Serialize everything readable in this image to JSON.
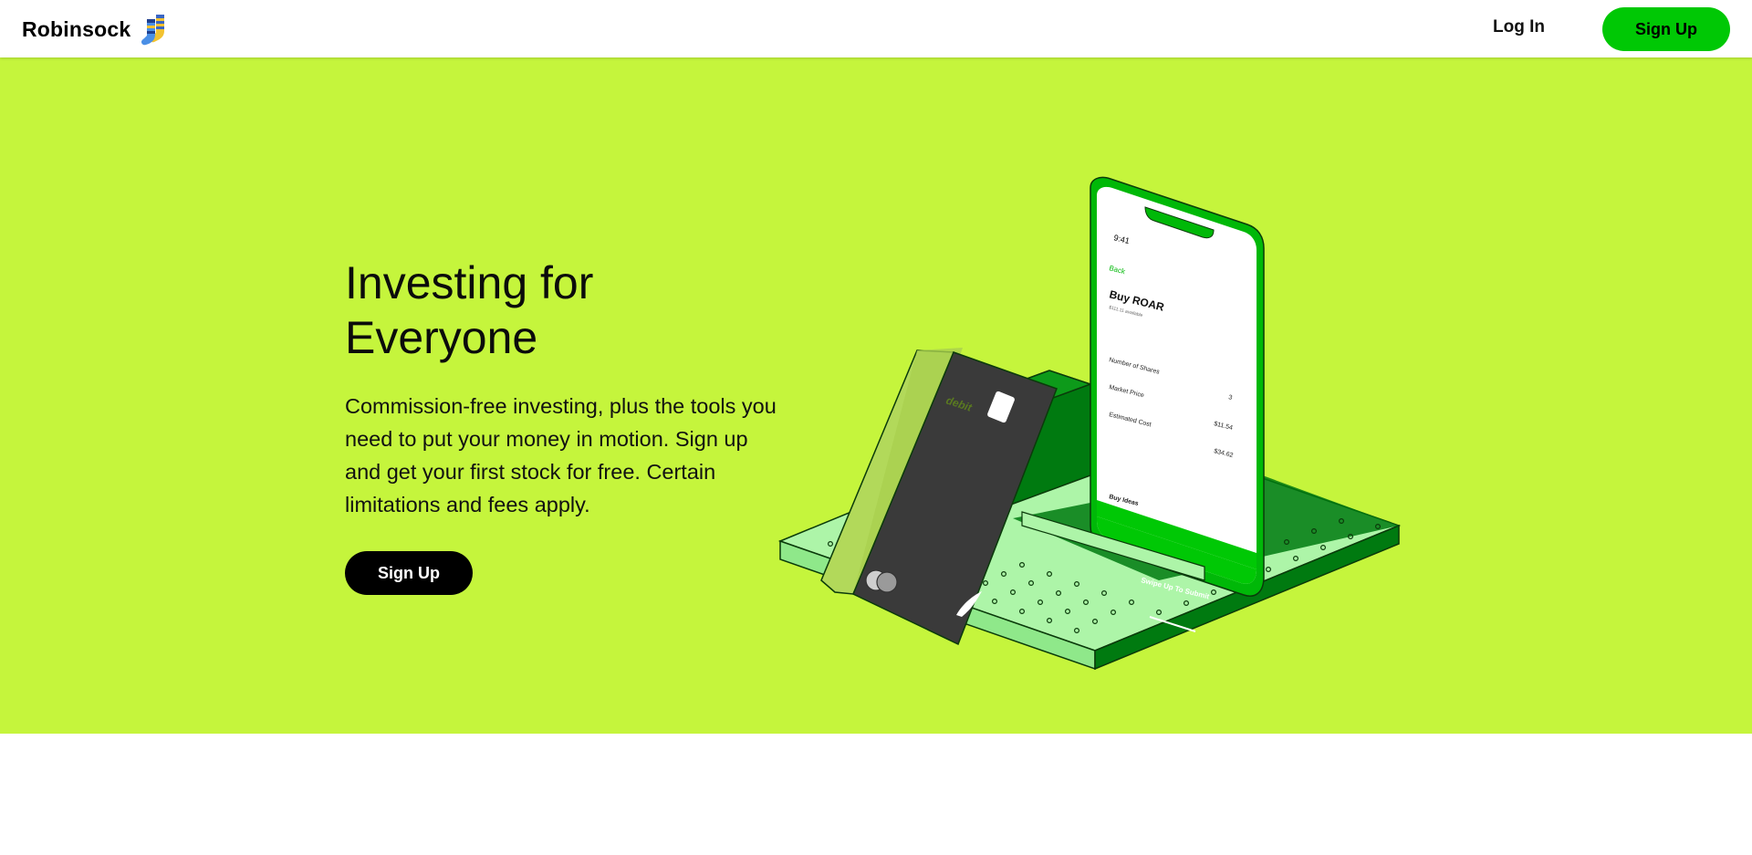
{
  "nav": {
    "brand": "Robinsock",
    "login_label": "Log In",
    "signup_label": "Sign Up"
  },
  "hero": {
    "title": "Investing for Everyone",
    "text": "Commission-free investing, plus the tools you need to put your money in motion. Sign up and get your first stock for free. Certain limitations and fees apply.",
    "signup_label": "Sign Up"
  },
  "phone": {
    "time": "9:41",
    "back": "Back",
    "heading": "Buy ROAR",
    "subheading": "$111.11 available",
    "rows": [
      "Number of Shares",
      "Market Price",
      "Estimated Cost"
    ],
    "values": [
      "3",
      "$11.54",
      "$34.62"
    ],
    "note_title": "Buy Ideas",
    "swipe": "Swipe Up To Submit"
  },
  "card": {
    "label": "debit"
  },
  "colors": {
    "hero_bg": "#c5f53c",
    "brand_green": "#00c805",
    "dark_green": "#007a10",
    "light_green": "#adf5a8",
    "card_dark": "#3a3a3a"
  }
}
